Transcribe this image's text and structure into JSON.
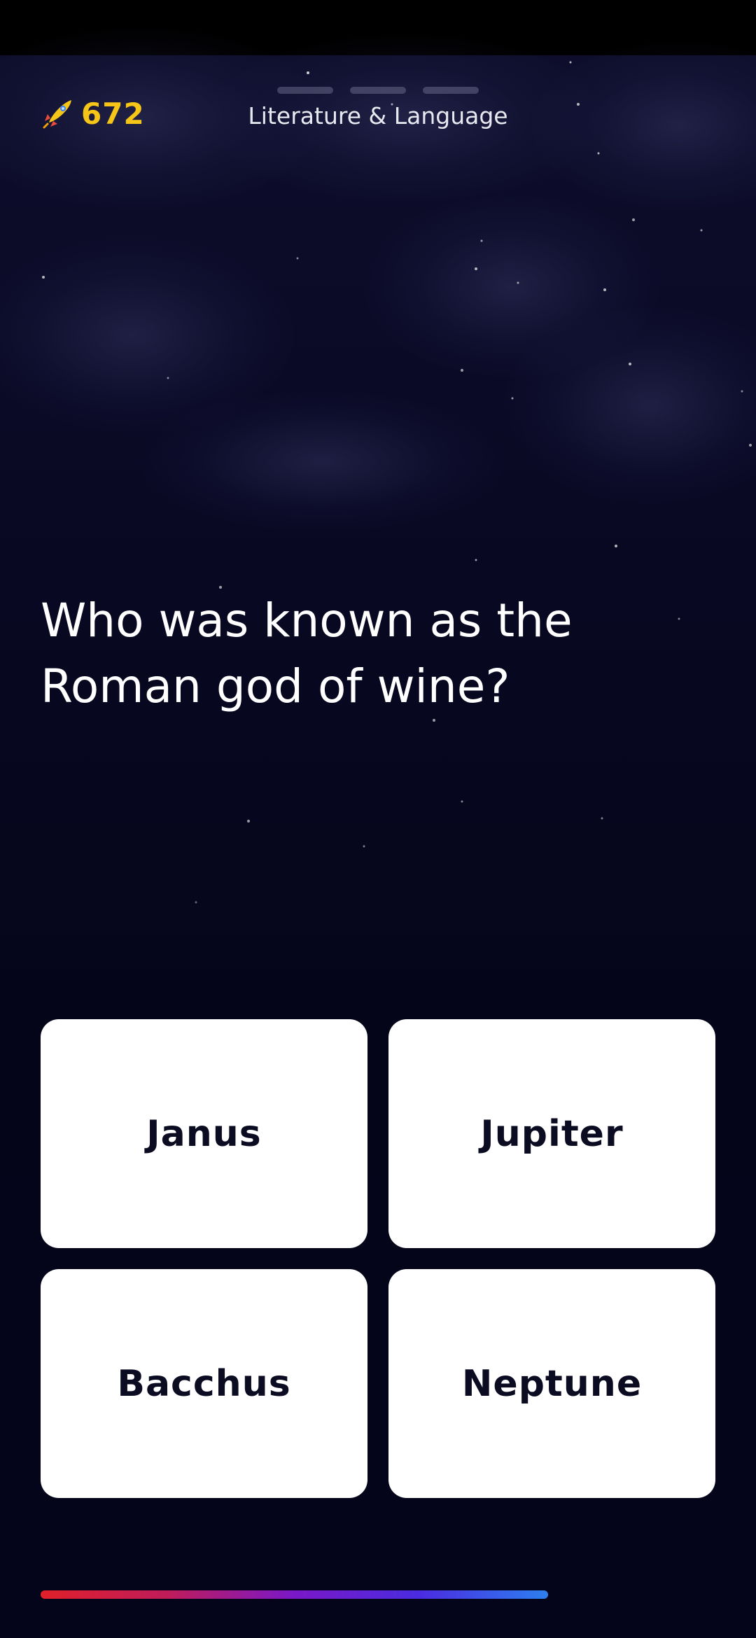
{
  "header": {
    "score": "672",
    "category": "Literature & Language",
    "question_progress": {
      "total": 3
    }
  },
  "question": {
    "text_line1": "Who was known as the",
    "text_line2": "Roman god of wine?"
  },
  "answers": [
    {
      "label": "Janus"
    },
    {
      "label": "Jupiter"
    },
    {
      "label": "Bacchus"
    },
    {
      "label": "Neptune"
    }
  ],
  "timer": {
    "remaining_fraction": 0.75
  },
  "colors": {
    "score": "#f5c518",
    "background": "#04041a",
    "answer_card": "#ffffff",
    "answer_text": "#0b0b22",
    "timer_start": "#e0202a",
    "timer_end": "#2d7ff0"
  },
  "icons": {
    "score_icon": "rocket-icon"
  }
}
